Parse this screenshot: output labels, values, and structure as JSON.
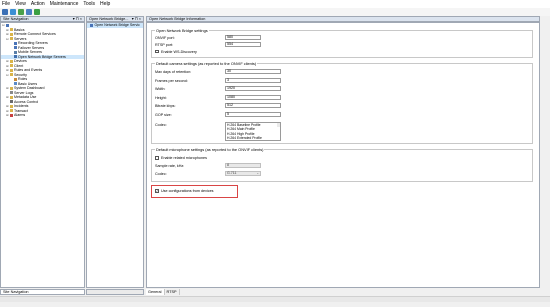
{
  "menu": [
    "File",
    "View",
    "Action",
    "Maintenance",
    "Tools",
    "Help"
  ],
  "toolbar_icons": [
    "save-icon",
    "help-icon",
    "refresh-icon",
    "back-icon",
    "play-icon"
  ],
  "site_navigation": {
    "title": "Site Navigation",
    "controls": "▾ ⊓ ×",
    "footer": "Site Navigation",
    "items": [
      {
        "label": "",
        "level": 0,
        "icon": "server-icon",
        "expander": "⊟"
      },
      {
        "label": "Basics",
        "level": 1,
        "icon": "folder-icon",
        "expander": "⊞"
      },
      {
        "label": "Remote Connect Services",
        "level": 1,
        "icon": "folder-icon",
        "expander": "⊞"
      },
      {
        "label": "Servers",
        "level": 1,
        "icon": "folder-icon",
        "expander": "⊟"
      },
      {
        "label": "Recording Servers",
        "level": 2,
        "icon": "server-icon",
        "expander": ""
      },
      {
        "label": "Failover Servers",
        "level": 2,
        "icon": "server-icon",
        "expander": ""
      },
      {
        "label": "Mobile Servers",
        "level": 2,
        "icon": "mobile-icon",
        "expander": ""
      },
      {
        "label": "Open Network Bridge Servers",
        "level": 2,
        "icon": "bridge-icon",
        "expander": "",
        "selected": true
      },
      {
        "label": "Devices",
        "level": 1,
        "icon": "folder-icon",
        "expander": "⊞"
      },
      {
        "label": "Client",
        "level": 1,
        "icon": "folder-icon",
        "expander": "⊞"
      },
      {
        "label": "Rules and Events",
        "level": 1,
        "icon": "folder-icon",
        "expander": "⊞"
      },
      {
        "label": "Security",
        "level": 1,
        "icon": "folder-icon",
        "expander": "⊟"
      },
      {
        "label": "Roles",
        "level": 2,
        "icon": "roles-icon",
        "expander": ""
      },
      {
        "label": "Basic Users",
        "level": 2,
        "icon": "user-icon",
        "expander": ""
      },
      {
        "label": "System Dashboard",
        "level": 1,
        "icon": "folder-icon",
        "expander": "⊞"
      },
      {
        "label": "Server Logs",
        "level": 1,
        "icon": "log-icon",
        "expander": ""
      },
      {
        "label": "Metadata Use",
        "level": 1,
        "icon": "folder-icon",
        "expander": "⊞"
      },
      {
        "label": "Access Control",
        "level": 1,
        "icon": "access-icon",
        "expander": ""
      },
      {
        "label": "Incidents",
        "level": 1,
        "icon": "folder-icon",
        "expander": "⊞"
      },
      {
        "label": "Transact",
        "level": 1,
        "icon": "folder-icon",
        "expander": "⊞"
      },
      {
        "label": "Alarms",
        "level": 1,
        "icon": "alarm-icon",
        "expander": "⊞"
      }
    ]
  },
  "overview": {
    "title": "Open Network Bridge...",
    "controls": "▾ ⊓ ×",
    "item": "Open Network Bridge Servic"
  },
  "properties": {
    "title": "Open Network Bridge Information",
    "onvif_group": {
      "title": "Open Network Bridge settings",
      "onvif_port_label": "ONVIF port:",
      "onvif_port_value": "580",
      "rtsp_port_label": "RTSP port:",
      "rtsp_port_value": "554",
      "ws_discovery_label": "Enable WS-Discovery",
      "ws_discovery_checked": false
    },
    "camera_group": {
      "title": "Default camera settings (as reported to the ONVIF clients)",
      "rows": [
        {
          "label": "Max days of retention:",
          "value": "30"
        },
        {
          "label": "Frames per second:",
          "value": "3"
        },
        {
          "label": "Width:",
          "value": "1920"
        },
        {
          "label": "Height:",
          "value": "1080"
        },
        {
          "label": "Bitrate kbps:",
          "value": "512"
        },
        {
          "label": "GOP size:",
          "value": "5"
        }
      ],
      "codec_label": "Codec:",
      "codecs": [
        "H.264 Baseline Profile",
        "H.264 Main Profile",
        "H.264 High Profile",
        "H.264 Extended Profile"
      ]
    },
    "mic_group": {
      "title": "Default microphone settings (as reported to the ONVIF clients)",
      "enable_mics_label": "Enable related microphones",
      "enable_mics_checked": false,
      "sample_rate_label": "Sample rate, kHz:",
      "sample_rate_value": "8",
      "codec_label": "Codec:",
      "codec_value": "G.711"
    },
    "use_config_label": "Use configurations from devices",
    "use_config_checked": true
  },
  "bottom_tabs": [
    "General",
    "RTSP"
  ],
  "colors": {
    "highlight": "#d94545",
    "selection": "#cde6fb",
    "pane_header": "#dbe3ee"
  }
}
